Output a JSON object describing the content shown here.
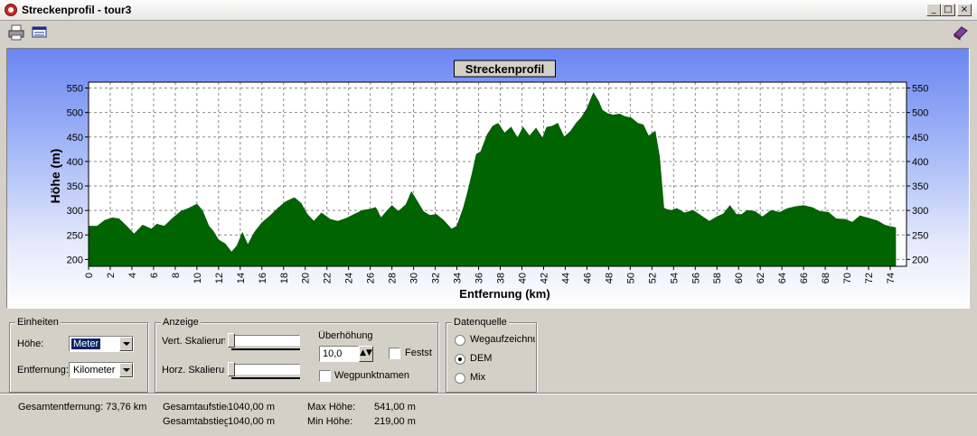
{
  "window": {
    "title": "Streckenprofil - tour3",
    "minimize": "_",
    "maximize": "□",
    "close": "×"
  },
  "toolbar": {
    "icons": [
      "printer-icon",
      "table-icon",
      "book-icon"
    ]
  },
  "chart_data": {
    "type": "area",
    "title": "Streckenprofil",
    "xlabel": "Entfernung (km)",
    "ylabel": "Höhe (m)",
    "xlim": [
      0,
      75.5
    ],
    "ylim": [
      186,
      562
    ],
    "grid": true,
    "x_ticks": [
      0,
      2,
      4,
      6,
      8,
      10,
      12,
      14,
      16,
      18,
      20,
      22,
      24,
      26,
      28,
      30,
      32,
      34,
      36,
      38,
      40,
      42,
      44,
      46,
      48,
      50,
      52,
      54,
      56,
      58,
      60,
      62,
      64,
      66,
      68,
      70,
      72,
      74
    ],
    "y_ticks": [
      200,
      250,
      300,
      350,
      400,
      450,
      500,
      550
    ],
    "fill_color": "#006400",
    "series": [
      {
        "x": [
          0,
          0.8,
          1.5,
          2.2,
          2.8,
          3.5,
          4.2,
          5.0,
          5.8,
          6.3,
          7.0,
          7.8,
          8.5,
          9.3,
          10.0,
          10.5,
          11.1,
          11.5,
          12.0,
          12.6,
          13.2,
          13.7,
          14.2,
          14.7,
          15.3,
          16.0,
          16.8,
          17.5,
          18.2,
          19.0,
          19.6,
          20.2,
          20.8,
          21.5,
          22.3,
          23.0,
          23.8,
          24.5,
          25.3,
          26.0,
          26.5,
          27.0,
          27.5,
          28.0,
          28.6,
          29.3,
          29.8,
          30.3,
          30.9,
          31.5,
          32.1,
          32.8,
          33.5,
          34.0,
          34.6,
          35.0,
          35.4,
          35.8,
          36.2,
          36.8,
          37.3,
          37.8,
          38.4,
          39.0,
          39.6,
          40.1,
          40.7,
          41.3,
          41.9,
          42.3,
          42.8,
          43.3,
          43.9,
          44.5,
          45.0,
          45.5,
          46.0,
          46.6,
          47.1,
          47.4,
          47.9,
          48.4,
          49.0,
          49.5,
          50.1,
          50.7,
          51.2,
          51.7,
          52.3,
          52.7,
          53.1,
          53.4,
          53.8,
          54.3,
          55.0,
          55.8,
          56.5,
          57.3,
          58.0,
          58.6,
          59.2,
          59.8,
          60.3,
          60.8,
          61.5,
          62.2,
          63.0,
          63.8,
          64.5,
          65.3,
          66.0,
          66.8,
          67.5,
          68.3,
          69.0,
          69.8,
          70.5,
          71.2,
          72.0,
          72.8,
          73.5,
          74.0,
          74.5
        ],
        "y": [
          268,
          268,
          280,
          285,
          283,
          268,
          252,
          270,
          262,
          272,
          268,
          285,
          298,
          305,
          313,
          300,
          268,
          258,
          240,
          232,
          215,
          228,
          255,
          230,
          255,
          275,
          290,
          305,
          318,
          326,
          315,
          292,
          278,
          295,
          282,
          278,
          284,
          292,
          300,
          303,
          306,
          285,
          298,
          310,
          298,
          312,
          338,
          320,
          298,
          290,
          292,
          279,
          262,
          268,
          305,
          338,
          375,
          415,
          420,
          455,
          472,
          478,
          458,
          470,
          448,
          470,
          452,
          468,
          448,
          470,
          472,
          478,
          450,
          462,
          478,
          490,
          508,
          540,
          522,
          505,
          498,
          495,
          497,
          492,
          489,
          478,
          475,
          452,
          462,
          410,
          305,
          302,
          300,
          304,
          295,
          300,
          290,
          278,
          287,
          293,
          310,
          292,
          292,
          300,
          298,
          287,
          300,
          296,
          304,
          308,
          310,
          306,
          298,
          296,
          283,
          282,
          276,
          289,
          284,
          279,
          270,
          267,
          265
        ]
      }
    ]
  },
  "settings": {
    "einheiten": {
      "label": "Einheiten",
      "hoehe_label": "Höhe:",
      "hoehe_value": "Meter",
      "entfernung_label": "Entfernung:",
      "entfernung_value": "Kilometer"
    },
    "anzeige": {
      "label": "Anzeige",
      "vert_label": "Vert. Skalierung",
      "horz_label": "Horz. Skalierung",
      "ueberhoehung_label": "Überhöhung",
      "ueberhoehung_value": "10,0",
      "fest_label": "Festst",
      "wegpunkt_label": "Wegpunktnamen"
    },
    "datenquelle": {
      "label": "Datenquelle",
      "options": [
        "Wegaufzeichnung",
        "DEM",
        "Mix"
      ],
      "selected": "DEM"
    }
  },
  "status": {
    "gesamtentfernung": "Gesamtentfernung: 73,76 km",
    "aufstieg_label": "Gesamtaufstieg:",
    "aufstieg_value": "1040,00 m",
    "abstieg_label": "Gesamtabstieg:",
    "abstieg_value": "1040,00 m",
    "max_label": "Max Höhe:",
    "max_value": "541,00 m",
    "min_label": "Min Höhe:",
    "min_value": "219,00 m"
  }
}
